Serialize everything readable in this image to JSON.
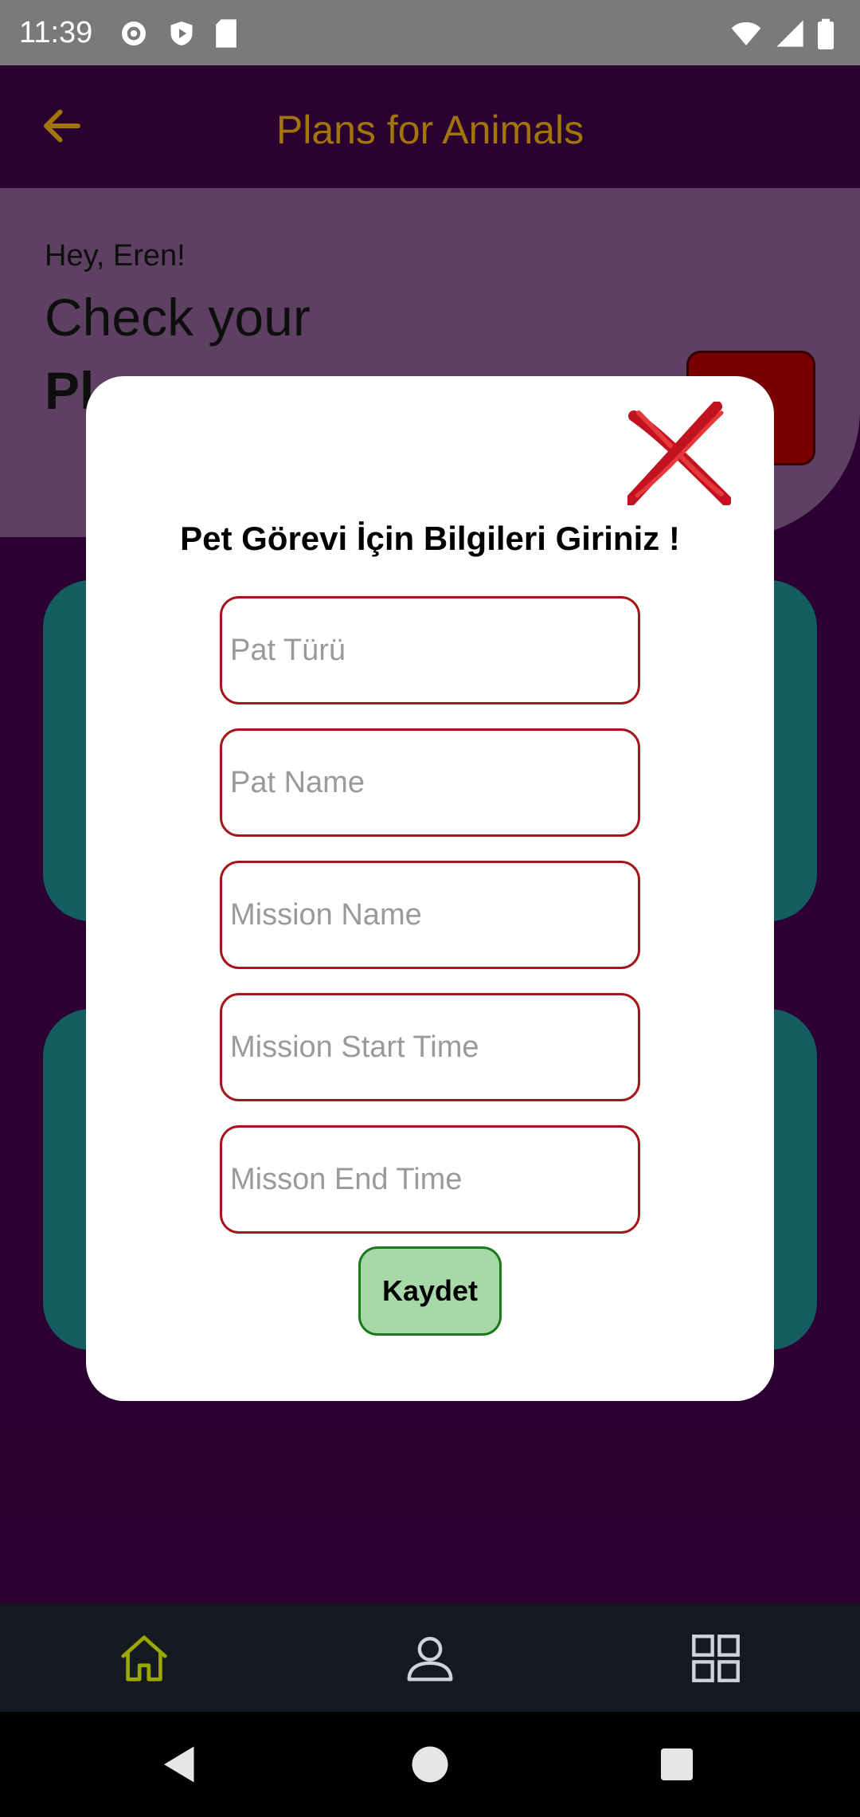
{
  "status_bar": {
    "time": "11:39"
  },
  "app_bar": {
    "title": "Plans for Animals"
  },
  "background": {
    "greeting": "Hey, Eren!",
    "headline_line1": "Check your",
    "headline_line2_partial": "Pl..."
  },
  "modal": {
    "title": "Pet Görevi İçin Bilgileri Giriniz !",
    "fields": [
      {
        "placeholder": "Pat Türü",
        "value": ""
      },
      {
        "placeholder": "Pat Name",
        "value": ""
      },
      {
        "placeholder": "Mission Name",
        "value": ""
      },
      {
        "placeholder": "Mission Start Time",
        "value": ""
      },
      {
        "placeholder": "Misson End Time",
        "value": ""
      }
    ],
    "save_label": "Kaydet"
  },
  "colors": {
    "app_bar": "#2f0036",
    "title": "#b8860b",
    "field_border": "#a4161a",
    "save_button": "#a8d8a8",
    "teal_card": "#176a6f"
  },
  "icons": {
    "back": "arrow-left-icon",
    "close": "close-x-icon",
    "nav_home": "home-icon",
    "nav_profile": "person-icon",
    "nav_grid": "grid-icon"
  }
}
